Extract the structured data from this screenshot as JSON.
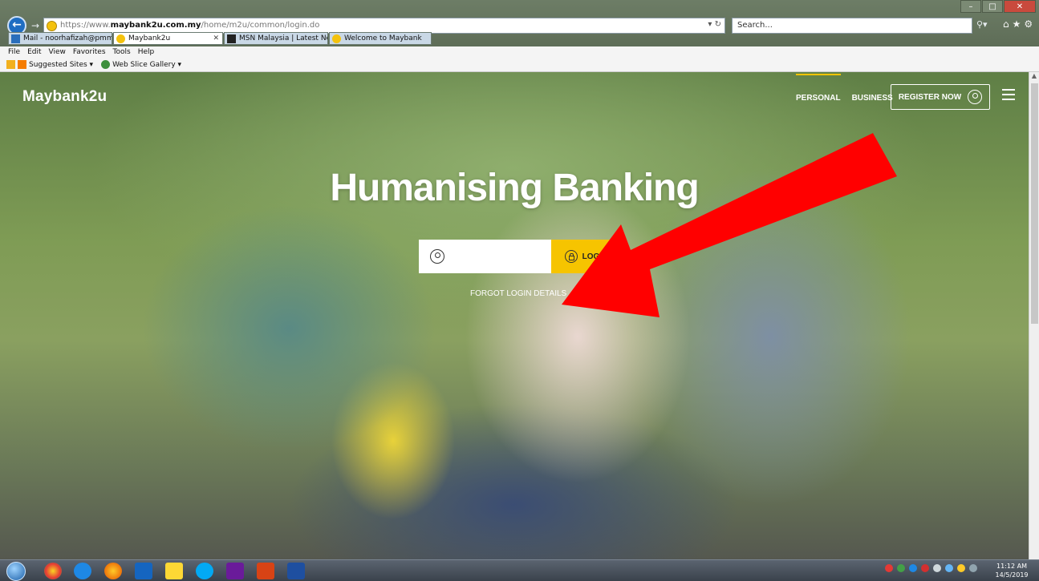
{
  "browser": {
    "url_prefix": "https://www.",
    "url_domain": "maybank2u.com.my",
    "url_path": "/home/m2u/common/login.do",
    "search_placeholder": "Search...",
    "tabs": [
      {
        "label": "Mail - noorhafizah@pmm.edu..."
      },
      {
        "label": "Maybank2u",
        "active": true
      },
      {
        "label": "MSN Malaysia | Latest News, H..."
      },
      {
        "label": "Welcome to Maybank"
      }
    ],
    "menu": [
      "File",
      "Edit",
      "View",
      "Favorites",
      "Tools",
      "Help"
    ],
    "favorites": [
      "Suggested Sites ▾",
      "Web Slice Gallery ▾"
    ]
  },
  "page": {
    "brand": "Maybank2u",
    "nav": [
      {
        "label": "PERSONAL",
        "active": true
      },
      {
        "label": "BUSINESS"
      }
    ],
    "register_label": "REGISTER NOW",
    "hero_title": "Humanising Banking",
    "login_label": "LOGIN",
    "forgot_label": "FORGOT LOGIN DETAILS"
  },
  "taskbar": {
    "time": "11:12 AM",
    "date": "14/5/2019"
  },
  "colors": {
    "accent_yellow": "#f6c400",
    "arrow_red": "#ff0000",
    "url_blue": "#1f6dc2"
  }
}
